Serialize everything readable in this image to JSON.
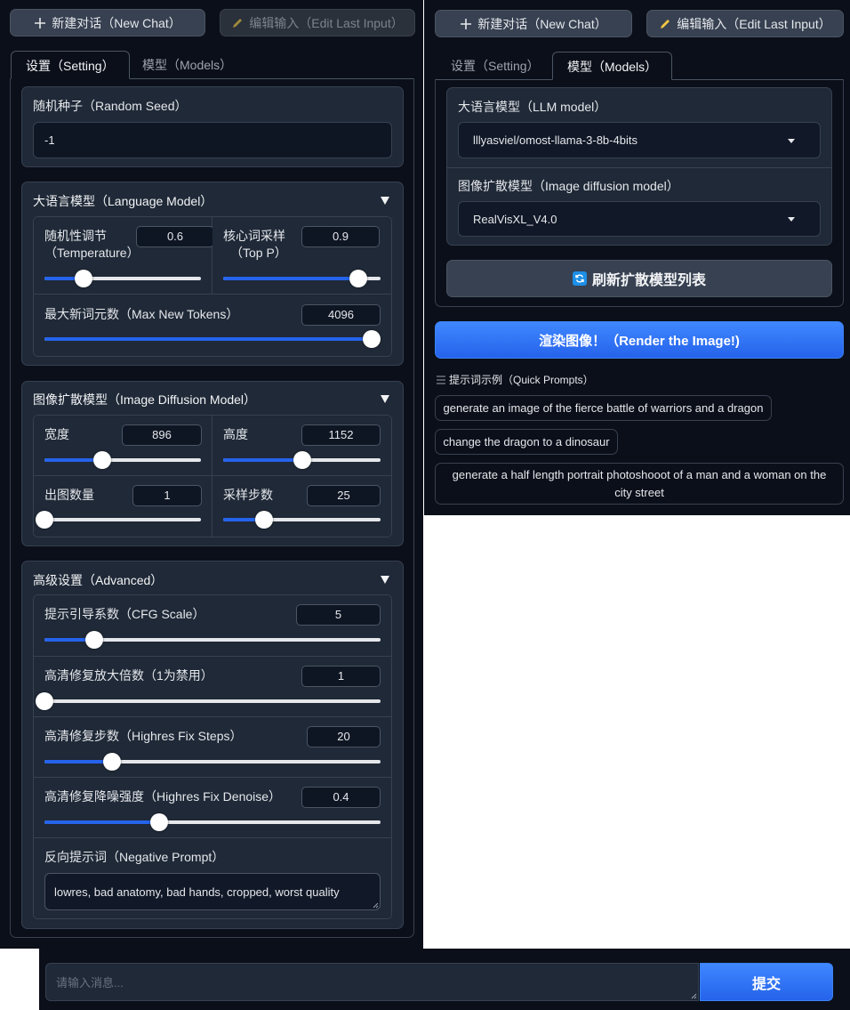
{
  "left": {
    "new_chat": "新建对话（New Chat）",
    "edit_last": "编辑输入（Edit Last Input）",
    "tabs": [
      "设置（Setting）",
      "模型（Models）"
    ],
    "seed": {
      "label": "随机种子（Random Seed）",
      "value": "-1"
    },
    "llm": {
      "title": "大语言模型（Language Model）",
      "temp_label_1": "随机性调节",
      "temp_label_2": "（Temperature）",
      "temp_value": "0.6",
      "temp_pct": 0.25,
      "topp_label_1": "核心词采样",
      "topp_label_2": "（Top P）",
      "topp_value": "0.9",
      "topp_pct": 0.86,
      "max_label": "最大新词元数（Max New Tokens）",
      "max_value": "4096",
      "max_pct": 1.0
    },
    "diffusion": {
      "title": "图像扩散模型（Image Diffusion Model）",
      "width_label": "宽度",
      "width_value": "896",
      "width_pct": 0.37,
      "height_label": "高度",
      "height_value": "1152",
      "height_pct": 0.5,
      "count_label": "出图数量",
      "count_value": "1",
      "count_pct": 0.0,
      "steps_label": "采样步数",
      "steps_value": "25",
      "steps_pct": 0.26
    },
    "advanced": {
      "title": "高级设置（Advanced）",
      "cfg_label": "提示引导系数（CFG Scale）",
      "cfg_value": "5",
      "cfg_pct": 0.148,
      "hr_scale_label": "高清修复放大倍数（1为禁用）",
      "hr_scale_value": "1",
      "hr_scale_pct": 0.0,
      "hr_steps_label": "高清修复步数（Highres Fix Steps）",
      "hr_steps_value": "20",
      "hr_steps_pct": 0.2,
      "hr_denoise_label": "高清修复降噪强度（Highres Fix Denoise）",
      "hr_denoise_value": "0.4",
      "hr_denoise_pct": 0.34,
      "neg_label": "反向提示词（Negative Prompt）",
      "neg_value": "lowres, bad anatomy, bad hands, cropped, worst quality"
    }
  },
  "right": {
    "new_chat": "新建对话（New Chat）",
    "edit_last": "编辑输入（Edit Last Input）",
    "tabs": [
      "设置（Setting）",
      "模型（Models）"
    ],
    "llm_model_label": "大语言模型（LLM model）",
    "llm_model_value": "lllyasviel/omost-llama-3-8b-4bits",
    "diff_model_label": "图像扩散模型（Image diffusion model）",
    "diff_model_value": "RealVisXL_V4.0",
    "refresh": "刷新扩散模型列表",
    "render": "渲染图像！（Render the Image!)",
    "quick_label": "提示词示例（Quick Prompts）",
    "prompts": [
      "generate an image of the fierce battle of warriors and a dragon",
      "change the dragon to a dinosaur",
      "generate a half length portrait photoshooot of a man and a woman on the city street"
    ]
  },
  "bottom": {
    "placeholder": "请输入消息...",
    "submit": "提交"
  },
  "colors": {
    "accent": "#2563eb",
    "bg": "#0b0f19",
    "block": "#1f2937",
    "border": "#374151"
  },
  "icons": {
    "plus": "plus-icon",
    "pencil": "pencil-icon",
    "refresh": "refresh-icon",
    "list": "list-icon",
    "caret": "caret-down-icon"
  }
}
